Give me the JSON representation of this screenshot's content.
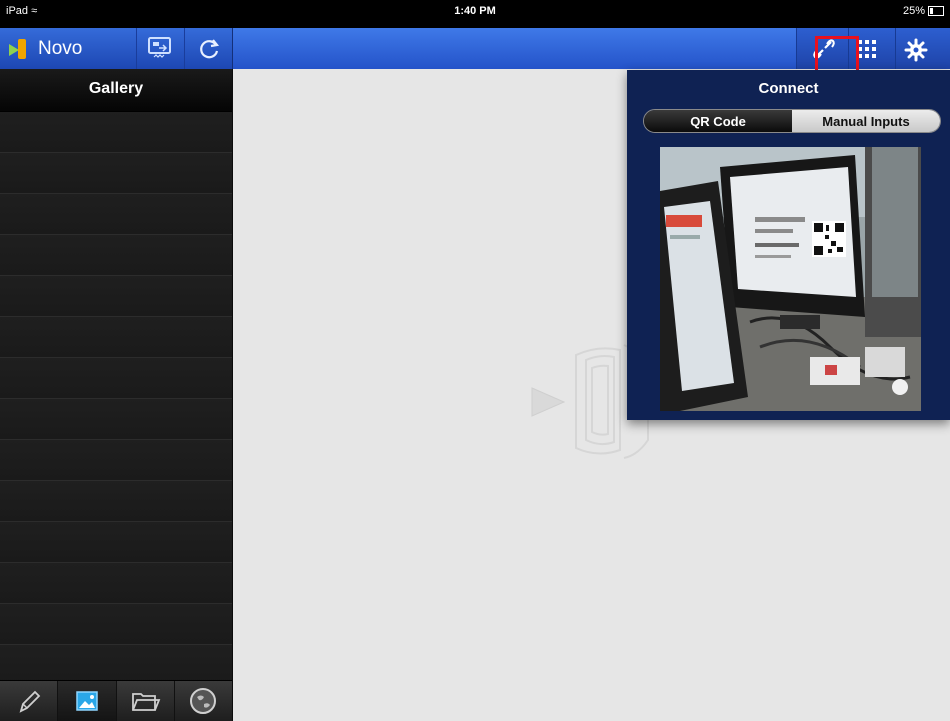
{
  "status_bar": {
    "device": "iPad",
    "time": "1:40 PM",
    "battery": "25%"
  },
  "app": {
    "name": "Novo"
  },
  "sidebar": {
    "title": "Gallery",
    "rows": 14,
    "tabs": [
      {
        "icon": "pencil-icon",
        "active": false
      },
      {
        "icon": "gallery-icon",
        "active": true
      },
      {
        "icon": "folder-icon",
        "active": false
      },
      {
        "icon": "globe-icon",
        "active": false
      }
    ]
  },
  "toolbar": {
    "icons": [
      "cast-screen-icon",
      "refresh-icon",
      "connect-icon",
      "grid-icon",
      "gear-icon"
    ]
  },
  "connect_popover": {
    "title": "Connect",
    "segments": [
      "QR Code",
      "Manual Inputs"
    ],
    "selected_segment": "QR Code"
  },
  "colors": {
    "toolbar": "#2a5fd6",
    "popover_bg": "#0f2253",
    "highlight": "#e8111e",
    "sidebar_bg": "#1b1b1b"
  }
}
